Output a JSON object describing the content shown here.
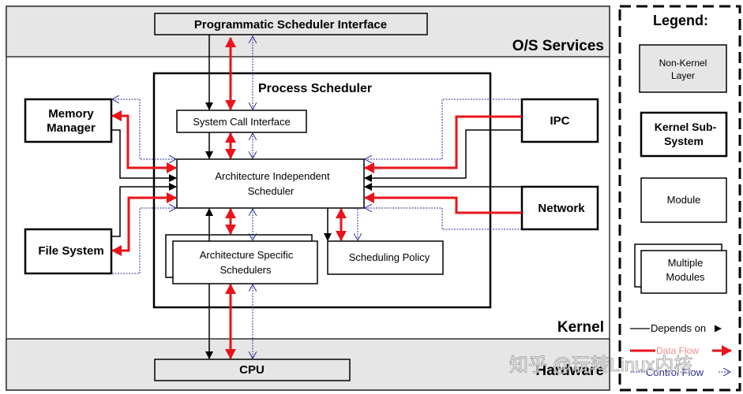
{
  "layers": {
    "os_services": "O/S Services",
    "kernel": "Kernel",
    "hardware": "Hardware"
  },
  "boxes": {
    "programmatic_interface": "Programmatic Scheduler Interface",
    "process_scheduler": "Process Scheduler",
    "system_call_interface": "System Call Interface",
    "arch_independent": [
      "Architecture Independent",
      "Scheduler"
    ],
    "arch_specific": [
      "Architecture Specific",
      "Schedulers"
    ],
    "scheduling_policy": "Scheduling Policy",
    "memory_manager": [
      "Memory",
      "Manager"
    ],
    "file_system": "File System",
    "ipc": "IPC",
    "network": "Network",
    "cpu": "CPU"
  },
  "legend": {
    "title": "Legend:",
    "non_kernel": [
      "Non-Kernel",
      "Layer"
    ],
    "kernel_sub": [
      "Kernel Sub-",
      "System"
    ],
    "module": "Module",
    "multiple": [
      "Multiple",
      "Modules"
    ],
    "depends": "Depends on",
    "data_flow": "Data Flow",
    "control_flow": "Control Flow"
  },
  "watermark": "知乎 @玩转Linux内核",
  "colors": {
    "layer_gray": "#e6e6e6",
    "data_flow": "#e8141a",
    "control_flow": "#2b2b9a",
    "depends": "#000000"
  }
}
